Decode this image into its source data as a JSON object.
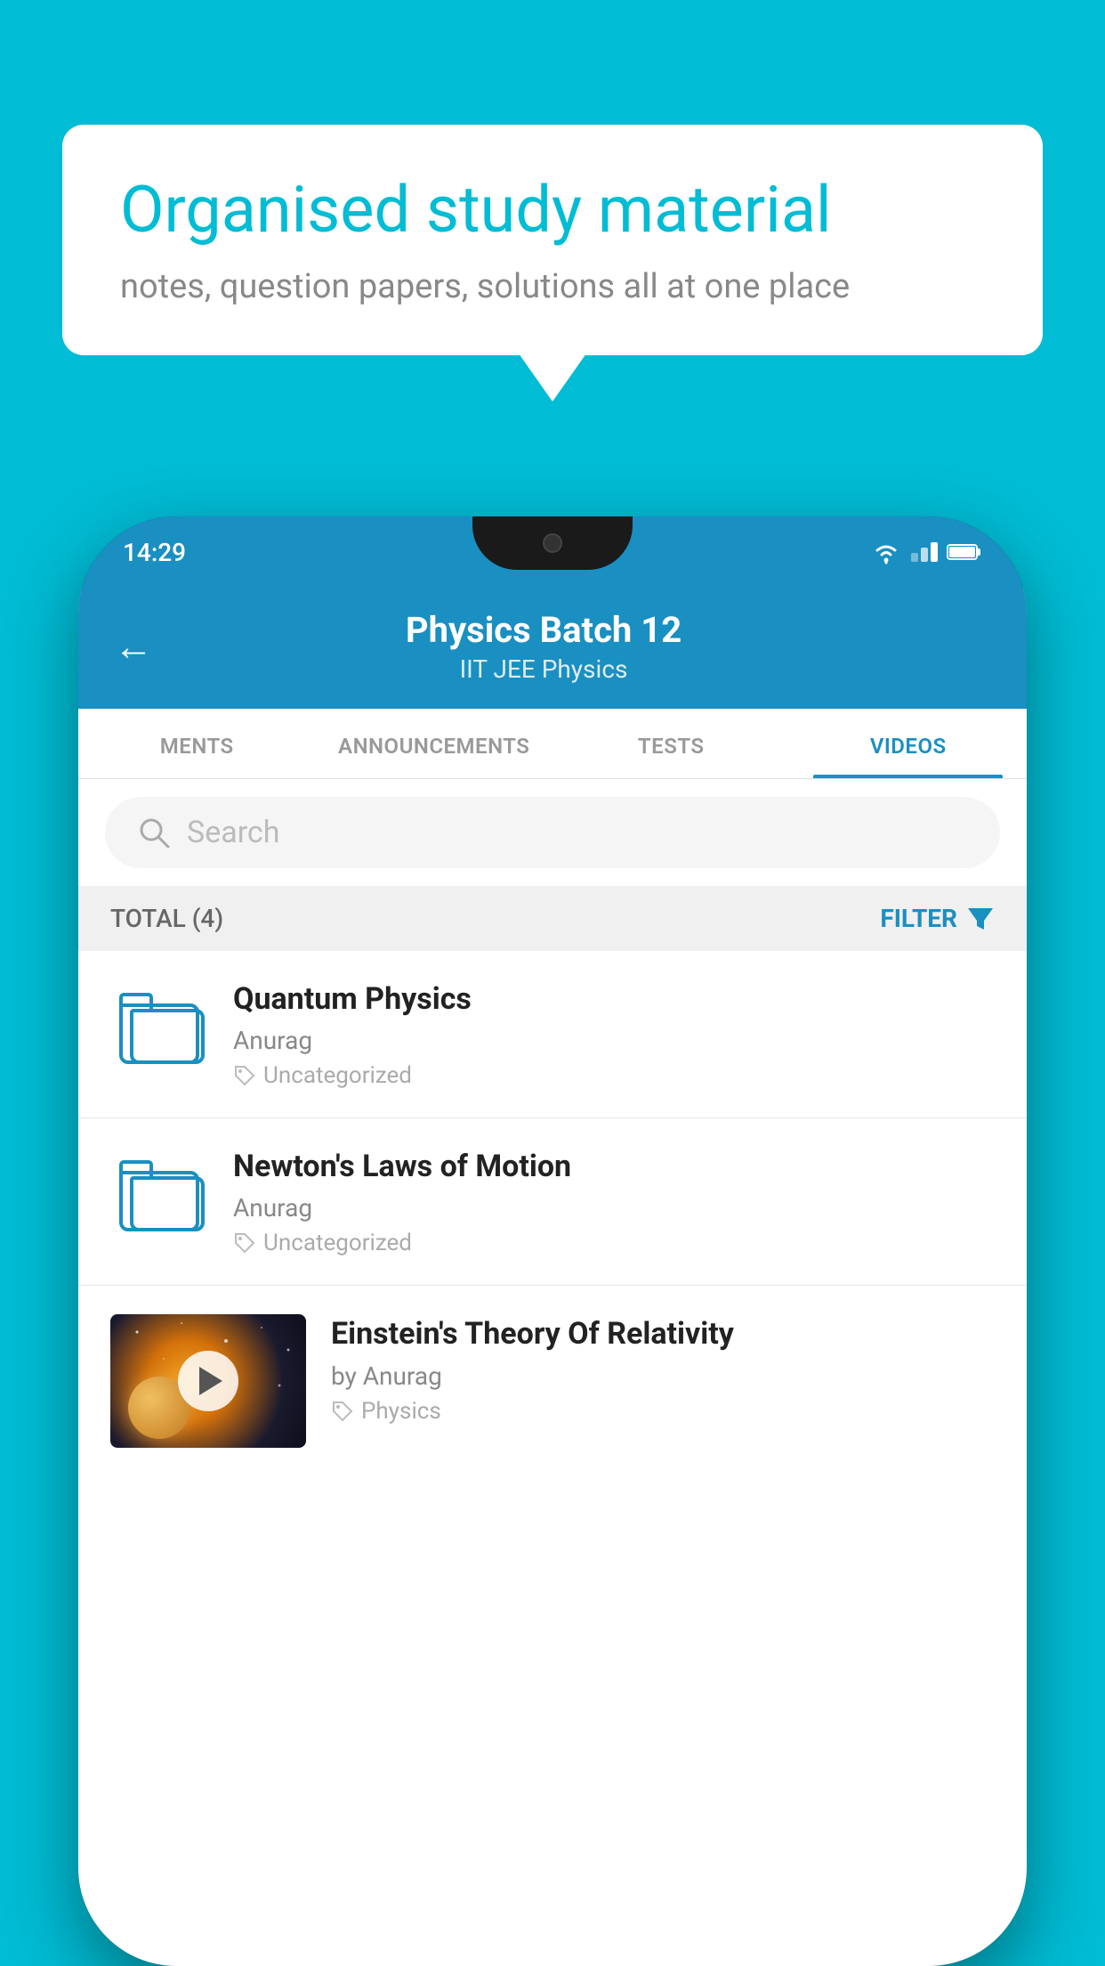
{
  "background": {
    "color": "#00bcd4"
  },
  "speech_bubble": {
    "title": "Organised study material",
    "subtitle": "notes, question papers, solutions all at one place"
  },
  "phone": {
    "status_bar": {
      "time": "14:29"
    },
    "header": {
      "title": "Physics Batch 12",
      "subtitle": "IIT JEE   Physics",
      "back_label": "←"
    },
    "tabs": [
      {
        "label": "MENTS",
        "active": false
      },
      {
        "label": "ANNOUNCEMENTS",
        "active": false
      },
      {
        "label": "TESTS",
        "active": false
      },
      {
        "label": "VIDEOS",
        "active": true
      }
    ],
    "search": {
      "placeholder": "Search"
    },
    "filter": {
      "total_label": "TOTAL (4)",
      "filter_label": "FILTER"
    },
    "videos": [
      {
        "title": "Quantum Physics",
        "author": "Anurag",
        "tag": "Uncategorized",
        "type": "folder"
      },
      {
        "title": "Newton's Laws of Motion",
        "author": "Anurag",
        "tag": "Uncategorized",
        "type": "folder"
      },
      {
        "title": "Einstein's Theory Of Relativity",
        "author": "by Anurag",
        "tag": "Physics",
        "type": "thumbnail"
      }
    ]
  }
}
